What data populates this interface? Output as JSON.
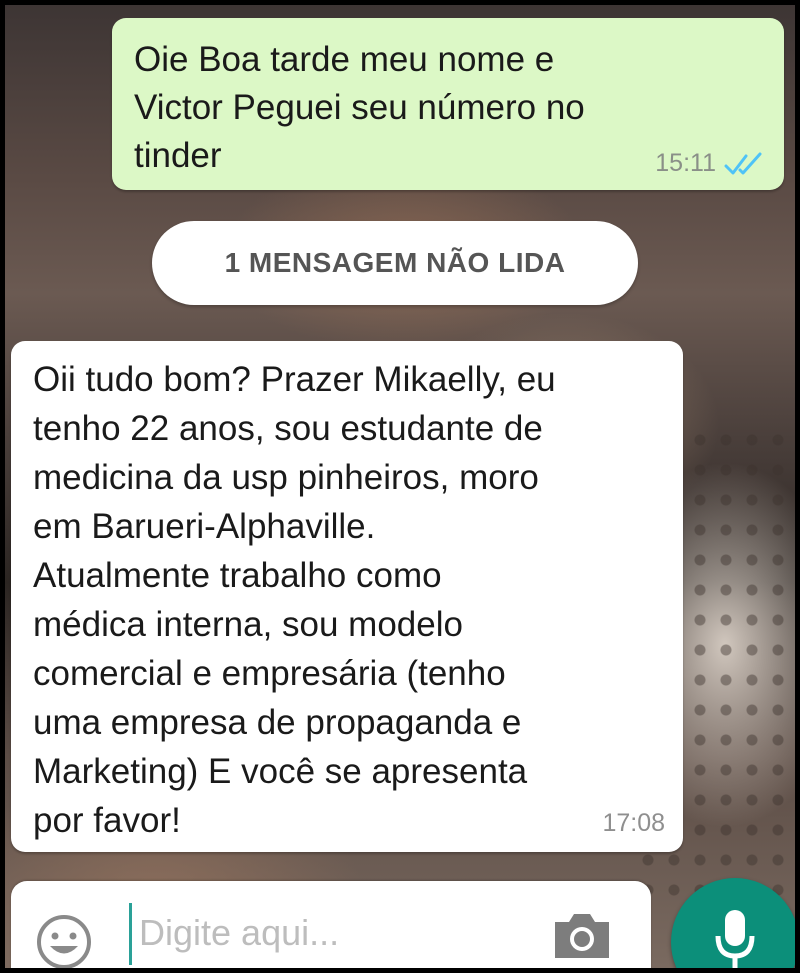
{
  "chat": {
    "outgoing": {
      "text": "Oie  Boa tarde meu nome e\nVictor Peguei seu número no\ntinder",
      "time": "15:11",
      "status_icon": "double-check-icon"
    },
    "unread_divider": "1 MENSAGEM NÃO LIDA",
    "incoming": {
      "text": "Oii tudo bom? Prazer Mikaelly, eu\ntenho 22 anos, sou estudante de\nmedicina da usp pinheiros, moro\nem Barueri-Alphaville.\nAtualmente trabalho como\nmédica interna, sou modelo\ncomercial e empresária (tenho\numa empresa de propaganda e\nMarketing) E você se apresenta\npor favor!",
      "time": "17:08"
    }
  },
  "composer": {
    "placeholder": "Digite aqui...",
    "value": "",
    "emoji_icon": "emoji-icon",
    "camera_icon": "camera-icon",
    "mic_icon": "mic-icon"
  },
  "colors": {
    "outgoing_bubble": "#dcf8c6",
    "incoming_bubble": "#ffffff",
    "read_ticks": "#4fc3f7",
    "mic_button": "#0c8f7a"
  }
}
